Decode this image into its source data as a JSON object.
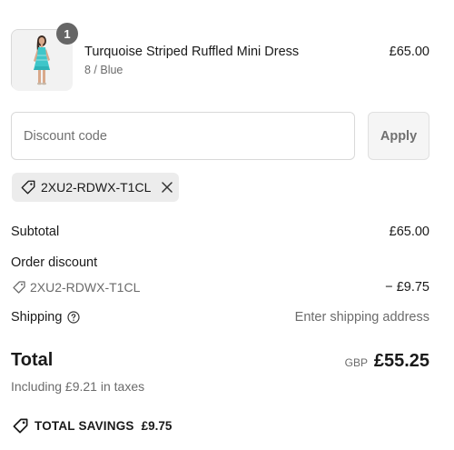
{
  "product": {
    "quantity": "1",
    "name": "Turquoise Striped Ruffled Mini Dress",
    "variant": "8 / Blue",
    "price": "£65.00",
    "image_icon": "dress-product-image"
  },
  "discount": {
    "placeholder": "Discount code",
    "value": "",
    "apply_label": "Apply",
    "applied_code": "2XU2-RDWX-T1CL"
  },
  "summary": {
    "subtotal_label": "Subtotal",
    "subtotal_value": "£65.00",
    "order_discount_label": "Order discount",
    "discount_code": "2XU2-RDWX-T1CL",
    "discount_value": "− £9.75",
    "shipping_label": "Shipping",
    "shipping_value": "Enter shipping address",
    "total_label": "Total",
    "currency": "GBP",
    "total_value": "£55.25",
    "taxes_text": "Including £9.21 in taxes",
    "savings_label": "TOTAL SAVINGS",
    "savings_value": "£9.75"
  },
  "colors": {
    "badge": "#666666",
    "muted_text": "#6b6b6b",
    "chip_bg": "#ececec",
    "dress": "#3fc6c9"
  }
}
